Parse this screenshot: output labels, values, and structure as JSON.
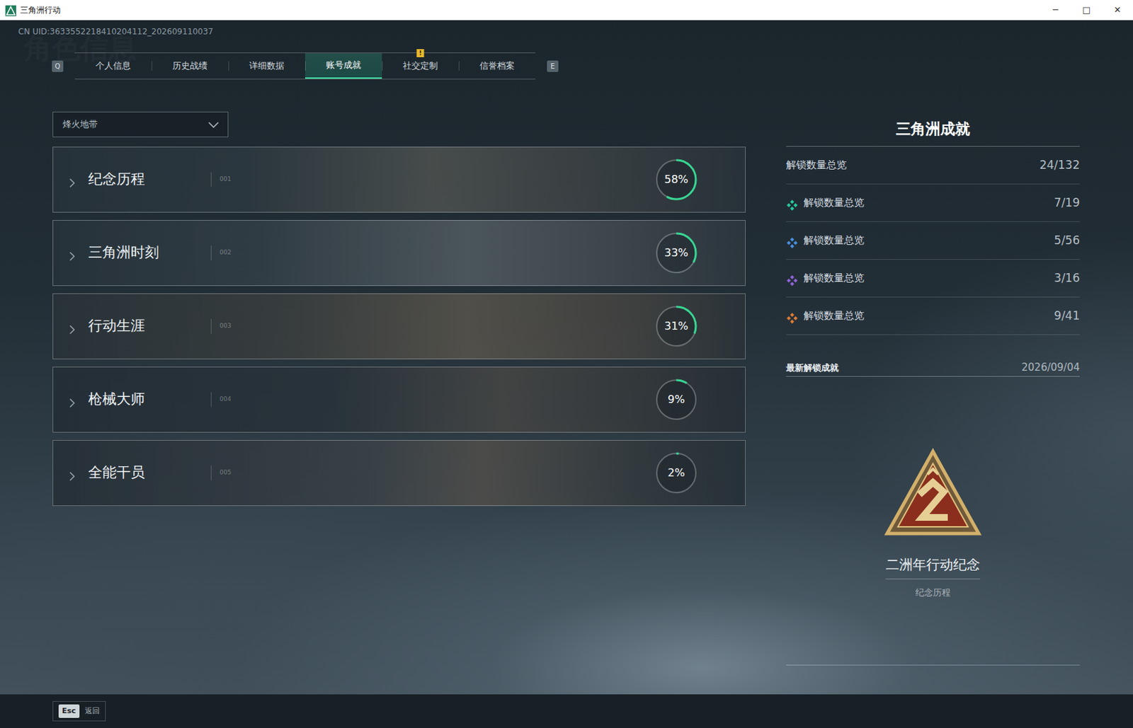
{
  "window": {
    "title": "三角洲行动",
    "controls": [
      "─",
      "□",
      "✕"
    ]
  },
  "uid": "CN UID:3633552218410204112_202609110037",
  "watermark": "角色信息",
  "tabs": {
    "prev_key": "Q",
    "next_key": "E",
    "alert_text": "!",
    "items": [
      {
        "label": "个人信息",
        "selected": false,
        "alert": false
      },
      {
        "label": "历史战绩",
        "selected": false,
        "alert": false
      },
      {
        "label": "详细数据",
        "selected": false,
        "alert": false
      },
      {
        "label": "账号成就",
        "selected": true,
        "alert": false
      },
      {
        "label": "社交定制",
        "selected": false,
        "alert": true
      },
      {
        "label": "信誉档案",
        "selected": false,
        "alert": false
      }
    ]
  },
  "mode_select": {
    "value": "烽火地带"
  },
  "categories": [
    {
      "name": "纪念历程",
      "number": "001",
      "percent": "58%",
      "level": 0.58
    },
    {
      "name": "三角洲时刻",
      "number": "002",
      "percent": "33%",
      "level": 0.33
    },
    {
      "name": "行动生涯",
      "number": "003",
      "percent": "31%",
      "level": 0.31
    },
    {
      "name": "枪械大师",
      "number": "004",
      "percent": "9%",
      "level": 0.09
    },
    {
      "name": "全能干员",
      "number": "005",
      "percent": "2%",
      "level": 0.02
    }
  ],
  "summary": {
    "title": "三角洲成就",
    "total": {
      "label": "解锁数量总览",
      "count": "24/132"
    },
    "tiers": [
      {
        "label": "解锁数量总览",
        "count": "7/19",
        "color": "#26c99a"
      },
      {
        "label": "解锁数量总览",
        "count": "5/56",
        "color": "#4a8fe0"
      },
      {
        "label": "解锁数量总览",
        "count": "3/16",
        "color": "#9063d8"
      },
      {
        "label": "解锁数量总览",
        "count": "9/41",
        "color": "#e07b35"
      }
    ]
  },
  "latest": {
    "title": "最新解锁成就",
    "date": "2026/09/04",
    "achievement": {
      "name": "二洲年行动纪念",
      "category": "纪念历程"
    }
  },
  "footer": {
    "key": "Esc",
    "label": "返回"
  }
}
